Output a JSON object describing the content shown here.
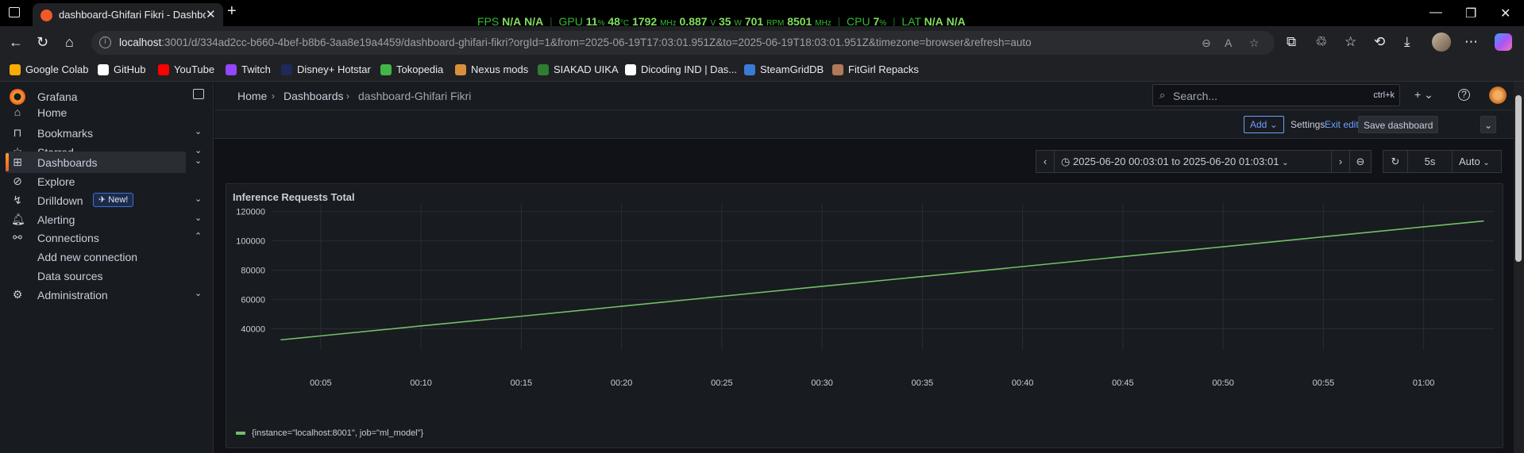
{
  "browser": {
    "tab_title": "dashboard-Ghifari Fikri - Dashboards - Grafana",
    "url_host": "localhost",
    "url_rest": ":3001/d/334ad2cc-b660-4bef-b8b6-3aa8e19a4459/dashboard-ghifari-fikri?orgId=1&from=2025-06-19T17:03:01.951Z&to=2025-06-19T18:03:01.951Z&timezone=browser&refresh=auto",
    "osd": {
      "fps_label": "FPS",
      "fps_1": "N/A",
      "fps_2": "N/A",
      "gpu_label": "GPU",
      "gpu_load": "11",
      "gpu_load_unit": "%",
      "gpu_temp": "48",
      "gpu_temp_unit": "°C",
      "gpu_clock": "1792",
      "gpu_clock_unit": "MHz",
      "gpu_volt": "0.887",
      "gpu_volt_unit": "V",
      "gpu_power": "35",
      "gpu_power_unit": "W",
      "gpu_fan": "701",
      "gpu_fan_unit": "RPM",
      "gpu_mem": "8501",
      "gpu_mem_unit": "MHz",
      "cpu_label": "CPU",
      "cpu_load": "7",
      "cpu_load_unit": "%",
      "lat_label": "LAT",
      "lat_1": "N/A",
      "lat_2": "N/A"
    },
    "bookmarks": [
      {
        "label": "Google Colab",
        "color": "#f9ab00"
      },
      {
        "label": "GitHub",
        "color": "#ffffff"
      },
      {
        "label": "YouTube",
        "color": "#ff0000"
      },
      {
        "label": "Twitch",
        "color": "#9146ff"
      },
      {
        "label": "Disney+ Hotstar",
        "color": "#1f2a5a"
      },
      {
        "label": "Tokopedia",
        "color": "#42b549"
      },
      {
        "label": "Nexus mods",
        "color": "#d98f40"
      },
      {
        "label": "SIAKAD UIKA",
        "color": "#2e7d32"
      },
      {
        "label": "Dicoding IND | Das...",
        "color": "#ffffff"
      },
      {
        "label": "SteamGridDB",
        "color": "#3a7bd5"
      },
      {
        "label": "FitGirl Repacks",
        "color": "#b07a5a"
      }
    ]
  },
  "grafana": {
    "brand": "Grafana",
    "nav": [
      {
        "label": "Home",
        "icon": "home-icon"
      },
      {
        "label": "Bookmarks",
        "icon": "bookmark-icon"
      },
      {
        "label": "Starred",
        "icon": "star-icon"
      },
      {
        "label": "Dashboards",
        "icon": "apps-icon"
      },
      {
        "label": "Explore",
        "icon": "compass-icon"
      },
      {
        "label": "Drilldown",
        "icon": "drilldown-icon"
      },
      {
        "label": "Alerting",
        "icon": "bell-icon"
      },
      {
        "label": "Connections",
        "icon": "connections-icon"
      },
      {
        "label": "Add new connection"
      },
      {
        "label": "Data sources"
      },
      {
        "label": "Administration",
        "icon": "cog-icon"
      }
    ],
    "new_badge": "New!",
    "breadcrumb": [
      "Home",
      "Dashboards",
      "dashboard-Ghifari Fikri"
    ],
    "search_placeholder": "Search...",
    "search_shortcut": "ctrl+k",
    "toolbar": {
      "add": "Add",
      "settings": "Settings",
      "exit_edit": "Exit edit",
      "save": "Save dashboard"
    },
    "time_range": "2025-06-20 00:03:01 to 2025-06-20 01:03:01",
    "refresh_interval": "5s",
    "refresh_mode": "Auto",
    "accent": "#f05a28",
    "link_color": "#6e9fff"
  },
  "chart_data": {
    "type": "line",
    "title": "Inference Requests Total",
    "series": [
      {
        "name": "{instance=\"localhost:8001\", job=\"ml_model\"}",
        "color": "#73bf69",
        "x": [
          "00:03",
          "00:05",
          "00:10",
          "00:15",
          "00:20",
          "00:25",
          "00:30",
          "00:35",
          "00:40",
          "00:45",
          "00:50",
          "00:55",
          "01:00",
          "01:03"
        ],
        "values": [
          32500,
          35200,
          42000,
          48600,
          55400,
          62200,
          69000,
          75700,
          82500,
          89300,
          96000,
          102800,
          109600,
          113600
        ]
      }
    ],
    "x_ticks": [
      "00:05",
      "00:10",
      "00:15",
      "00:20",
      "00:25",
      "00:30",
      "00:35",
      "00:40",
      "00:45",
      "00:50",
      "00:55",
      "01:00"
    ],
    "y_ticks": [
      "40000",
      "60000",
      "80000",
      "100000",
      "120000"
    ],
    "ylim": [
      30000,
      122000
    ],
    "grid": true,
    "legend": "bottom-left"
  }
}
